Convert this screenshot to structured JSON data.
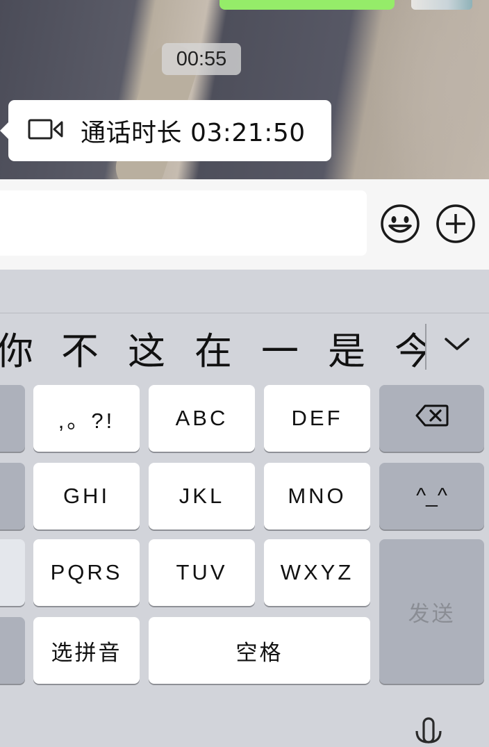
{
  "chat": {
    "timestamp": "00:55",
    "call_record": {
      "icon": "video-camera-icon",
      "text": "通话时长 03:21:50"
    }
  },
  "input_bar": {
    "text_value": "",
    "emoji_icon": "smiley-face-icon",
    "more_icon": "plus-circle-icon"
  },
  "keyboard": {
    "candidates": [
      "你",
      "不",
      "这",
      "在",
      "一",
      "是",
      "今"
    ],
    "expand_icon": "chevron-down-icon",
    "keys": {
      "punct": ",。?!",
      "abc": "ABC",
      "def": "DEF",
      "backspace_icon": "backspace-icon",
      "ghi": "GHI",
      "jkl": "JKL",
      "mno": "MNO",
      "emoticon": "^_^",
      "pqrs": "PQRS",
      "tuv": "TUV",
      "wxyz": "WXYZ",
      "send": "发送",
      "select_pinyin": "选拼音",
      "space": "空格"
    },
    "mic_icon": "microphone-icon"
  }
}
